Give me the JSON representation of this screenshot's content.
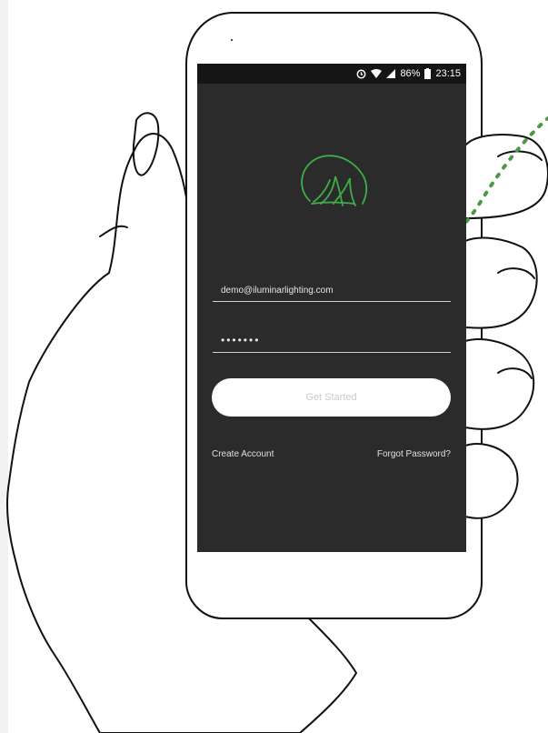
{
  "status_bar": {
    "icons": [
      "sync-icon",
      "wifi-icon",
      "signal-icon",
      "battery-icon"
    ],
    "battery": "86%",
    "time": "23:15"
  },
  "logo": {
    "icon": "leaf-logo-icon",
    "color": "#3dae49"
  },
  "login": {
    "email_value": "demo@iluminarlighting.com",
    "password_mask": "•••••••",
    "submit_label": "Get Started",
    "create_account_label": "Create Account",
    "forgot_password_label": "Forgot Password?"
  },
  "theme": {
    "screen_background": "#2b2b2b",
    "status_bar_background": "#151515",
    "accent_green": "#3dae49",
    "annotation_dots": "#4a9a45"
  }
}
